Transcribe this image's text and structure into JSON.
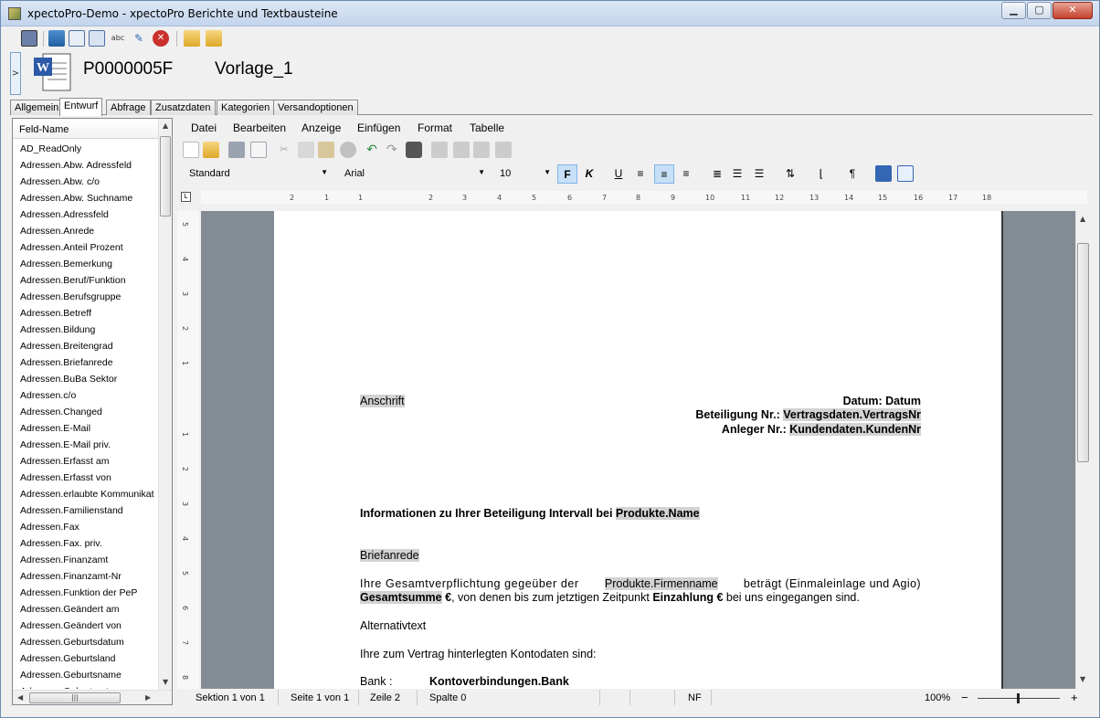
{
  "window": {
    "title": "xpectoPro-Demo - xpectoPro Berichte und Textbausteine"
  },
  "header": {
    "doc_id": "P0000005F",
    "doc_name": "Vorlage_1",
    "toggle": ">"
  },
  "tabs": [
    "Allgemein",
    "Entwurf",
    "Abfrage",
    "Zusatzdaten",
    "Kategorien",
    "Versandoptionen"
  ],
  "field_panel": {
    "column_header": "Feld-Name",
    "fields": [
      "AD_ReadOnly",
      "Adressen.Abw. Adressfeld",
      "Adressen.Abw. c/o",
      "Adressen.Abw. Suchname",
      "Adressen.Adressfeld",
      "Adressen.Anrede",
      "Adressen.Anteil Prozent",
      "Adressen.Bemerkung",
      "Adressen.Beruf/Funktion",
      "Adressen.Berufsgruppe",
      "Adressen.Betreff",
      "Adressen.Bildung",
      "Adressen.Breitengrad",
      "Adressen.Briefanrede",
      "Adressen.BuBa Sektor",
      "Adressen.c/o",
      "Adressen.Changed",
      "Adressen.E-Mail",
      "Adressen.E-Mail priv.",
      "Adressen.Erfasst am",
      "Adressen.Erfasst von",
      "Adressen.erlaubte Kommunikat",
      "Adressen.Familienstand",
      "Adressen.Fax",
      "Adressen.Fax. priv.",
      "Adressen.Finanzamt",
      "Adressen.Finanzamt-Nr",
      "Adressen.Funktion der PeP",
      "Adressen.Geändert am",
      "Adressen.Geändert von",
      "Adressen.Geburtsdatum",
      "Adressen.Geburtsland",
      "Adressen.Geburtsname",
      "Adressen.Geburtsort"
    ]
  },
  "menu": [
    "Datei",
    "Bearbeiten",
    "Anzeige",
    "Einfügen",
    "Format",
    "Tabelle"
  ],
  "format_bar": {
    "style": "Standard",
    "font": "Arial",
    "size": "10",
    "bold": "F",
    "italic": "K",
    "underline": "U",
    "pilcrow": "¶"
  },
  "ruler_numbers": [
    "2",
    "1",
    "1",
    "2",
    "3",
    "4",
    "5",
    "6",
    "7",
    "8",
    "9",
    "10",
    "11",
    "12",
    "13",
    "14",
    "15",
    "16",
    "17",
    "18"
  ],
  "vruler_numbers": [
    "5",
    "4",
    "3",
    "2",
    "1",
    "1",
    "2",
    "3",
    "4",
    "5",
    "6",
    "7",
    "8"
  ],
  "document": {
    "anschrift": "Anschrift",
    "datum": "Datum: Datum",
    "beteiligung_label": "Beteiligung Nr.: ",
    "beteiligung_field": "Vertragsdaten.VertragsNr",
    "anleger_label": "Anleger Nr.: ",
    "anleger_field": "Kundendaten.KundenNr",
    "heading_text": "Informationen zu Ihrer Beteiligung Intervall bei ",
    "heading_field": "Produkte.Name",
    "briefanrede": "Briefanrede",
    "para1_a": "Ihre Gesamtverpflichtung gegeüber der ",
    "para1_field": "Produkte.Firmenname",
    "para1_b": " beträgt (Einmaleinlage und Agio)",
    "para2_field": "Gesamtsumme",
    "para2_a": " €",
    "para2_b": ", von denen bis zum jetztigen Zeitpunkt ",
    "para2_c": "Einzahlung €",
    "para2_d": " bei uns eingegangen sind.",
    "alternativtext": "Alternativtext",
    "konto_text": "Ihre zum Vertrag hinterlegten Kontodaten sind:",
    "bank_label": "Bank :",
    "bank_field": "Kontoverbindungen.Bank"
  },
  "status": {
    "section": "Sektion 1 von 1",
    "page": "Seite 1 von 1",
    "line": "Zeile 2",
    "column": "Spalte 0",
    "nf": "NF",
    "zoom": "100%",
    "minus": "−",
    "plus": "+"
  }
}
